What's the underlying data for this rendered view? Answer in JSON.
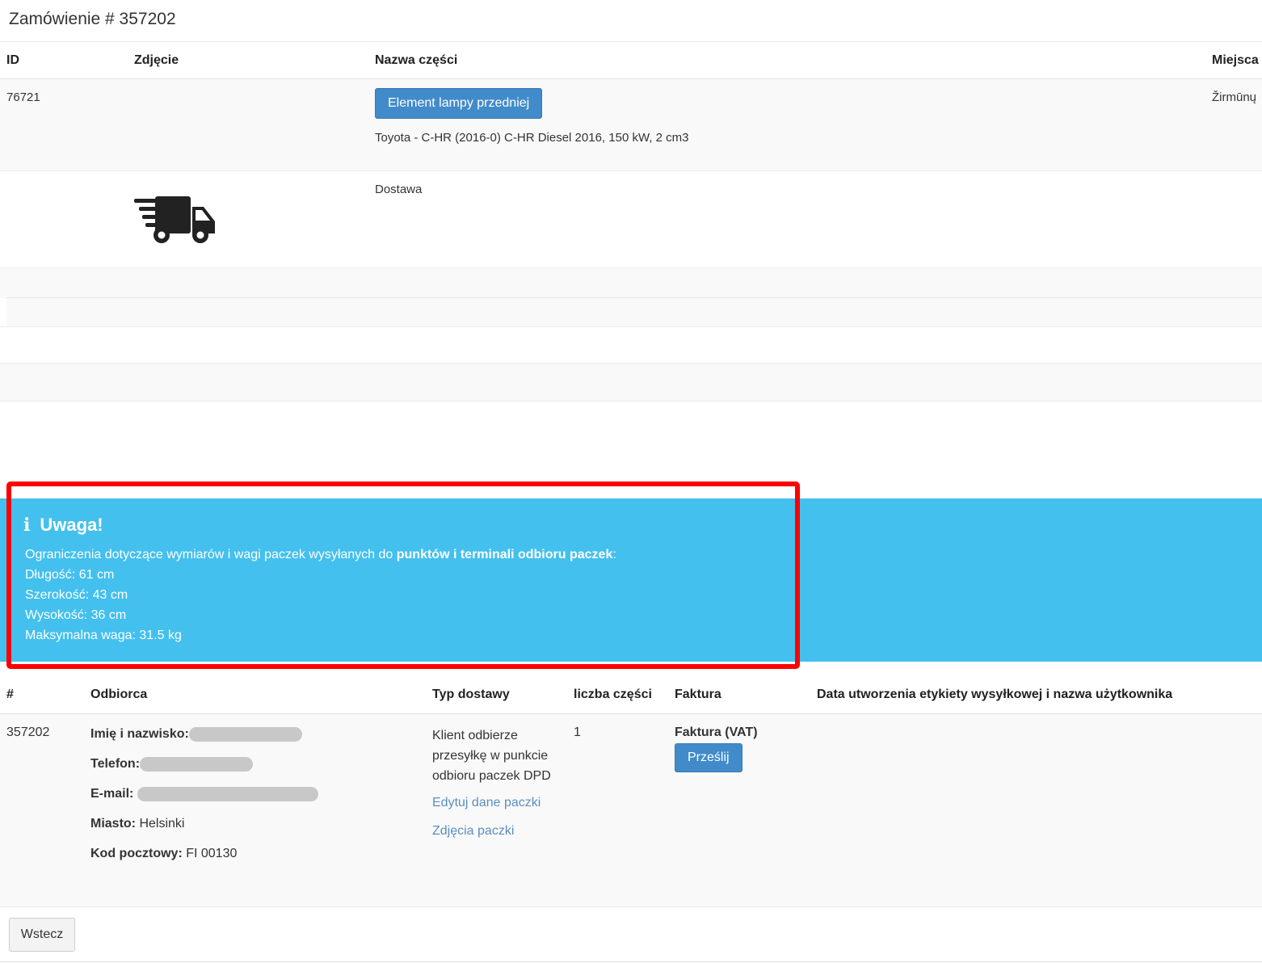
{
  "order": {
    "title": "Zamówienie # 357202"
  },
  "items_table": {
    "headers": {
      "id": "ID",
      "photo": "Zdjęcie",
      "part_name": "Nazwa części",
      "location": "Miejsca"
    },
    "part_row": {
      "id": "76721",
      "part_button": "Element lampy przedniej",
      "vehicle": "Toyota - C-HR (2016-0) C-HR Diesel 2016, 150 kW, 2 cm3",
      "location": "Žirmūnų"
    },
    "delivery_row": {
      "icon": "delivery-truck-icon",
      "label": "Dostawa"
    }
  },
  "alert": {
    "icon": "info-icon",
    "title": "Uwaga!",
    "intro_prefix": "Ograniczenia dotyczące wymiarów i wagi paczek wysyłanych do ",
    "intro_bold": "punktów i terminali odbioru paczek",
    "intro_suffix": ":",
    "lines": [
      "Długość: 61 cm",
      "Szerokość: 43 cm",
      "Wysokość: 36 cm",
      "Maksymalna waga: 31.5 kg"
    ],
    "color": "#43c0ee"
  },
  "shipments_table": {
    "headers": {
      "num": "#",
      "recipient": "Odbiorca",
      "delivery_type": "Typ dostawy",
      "parts_count": "liczba części",
      "invoice": "Faktura",
      "label_info": "Data utworzenia etykiety wysyłkowej i nazwa użytkownika"
    },
    "row": {
      "num": "357202",
      "name_label": "Imię i nazwisko:",
      "phone_label": "Telefon:",
      "email_label": "E-mail:",
      "city_label": "Miasto:",
      "city": "Helsinki",
      "postal_label": "Kod pocztowy:",
      "postal": "FI 00130",
      "delivery_type": "Klient odbierze przesyłkę w punkcie odbioru paczek DPD",
      "edit_link": "Edytuj dane paczki",
      "photos_link": "Zdjęcia paczki",
      "parts_count": "1",
      "invoice_type": "Faktura (VAT)",
      "send_button": "Prześlij"
    }
  },
  "back_button": "Wstecz",
  "colors": {
    "primary_button": "#428bca",
    "link": "#5a8fc1",
    "highlight_border": "#ff0000"
  }
}
